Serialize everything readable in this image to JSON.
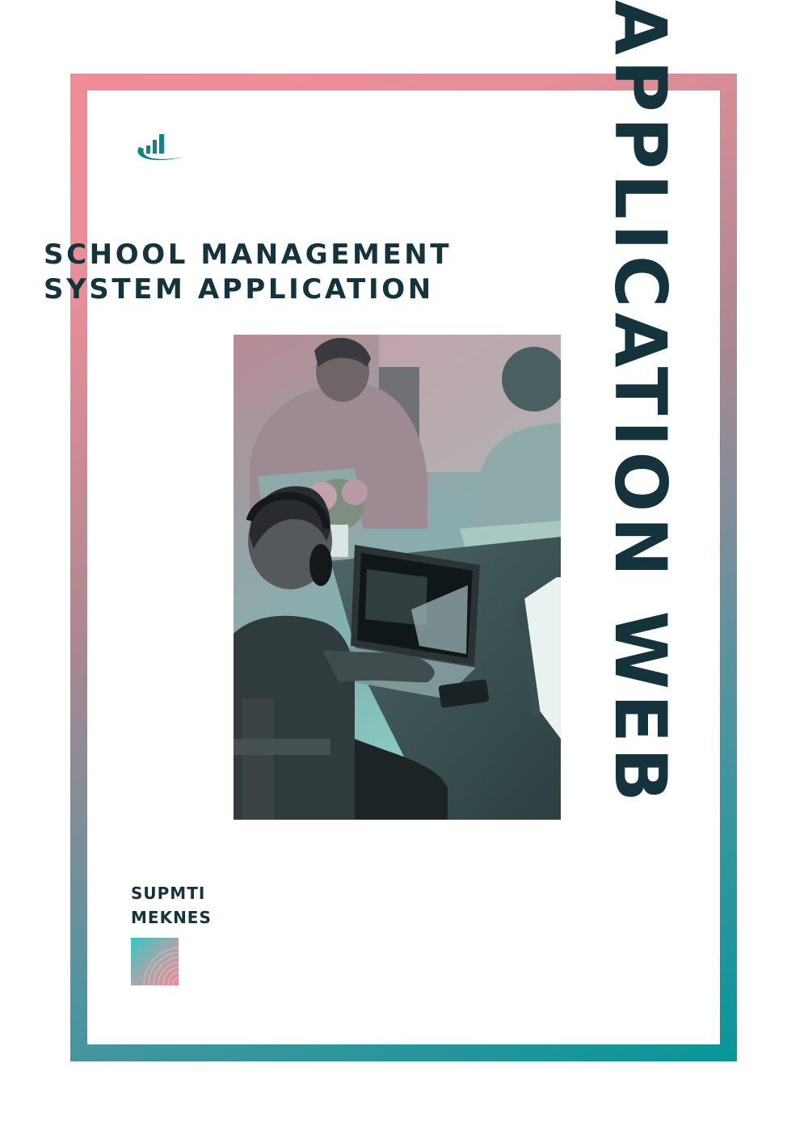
{
  "heading": {
    "line1": "SCHOOL MANAGEMENT",
    "line2": "SYSTEM APPLICATION"
  },
  "vertical_title": "APPLICATION WEB",
  "institution": {
    "line1": "SUPMTI",
    "line2": "MEKNES"
  },
  "logo_icon": "bar-chart-swoosh-icon",
  "colors": {
    "text_dark": "#14333d",
    "frame_pink": "#f08c97",
    "frame_teal": "#07969a",
    "logo_teal": "#0e8484"
  }
}
